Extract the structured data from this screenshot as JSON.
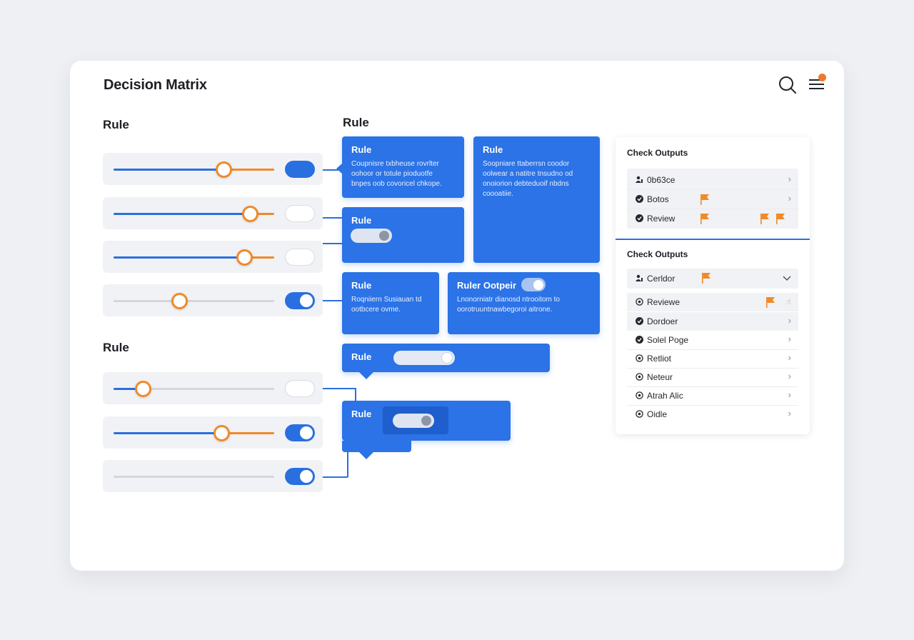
{
  "app": {
    "title": "Decision Matrix"
  },
  "left": {
    "section1_label": "Rule",
    "section2_label": "Rule"
  },
  "middle": {
    "section_label": "Rule",
    "cards": [
      {
        "title": "Rule",
        "body_lines": [
          "Coupnisre txbheuse rovrlter",
          "oohoor or totule pioduotfe",
          "bnpes oob covoricel chkope."
        ]
      },
      {
        "title": "Rule",
        "body_lines": [
          "Soopniare ttaberrsn coodor",
          "oolwear a natitre tnsudno od",
          "onoiorion debteduoif nbdns",
          "coooatiie."
        ]
      },
      {
        "title": "Rule"
      },
      {
        "title": "Rule",
        "body_lines": [
          "Roqniiern Susiauan td",
          "ootbcere ovme."
        ]
      },
      {
        "title": "Ruler Ootpeir",
        "body_lines": [
          "Lnonorniatr dianosd ntrooitom to",
          "oorotruuntnawbegoroi aitrone."
        ]
      },
      {
        "title": "Rule"
      },
      {
        "title": "Rule"
      }
    ]
  },
  "panel": {
    "title1": "Check Outputs",
    "rows1": [
      {
        "label": "0b63ce",
        "icon": "users-icon"
      },
      {
        "label": "Botos",
        "icon": "circle-check-icon"
      },
      {
        "label": "Review",
        "icon": "circle-check-icon"
      }
    ],
    "title2": "Check Outputs",
    "rows2": [
      {
        "label": "Cerldor",
        "icon": "users-icon"
      },
      {
        "label": "Reviewe",
        "icon": "circle-icon"
      },
      {
        "label": "Dordoer",
        "icon": "circle-check-icon"
      },
      {
        "label": "Solel Poge",
        "icon": "circle-check-icon"
      },
      {
        "label": "Retliot",
        "icon": "circle-icon"
      },
      {
        "label": "Neteur",
        "icon": "circle-icon"
      },
      {
        "label": "Atrah Alic",
        "icon": "circle-icon"
      },
      {
        "label": "Oidle",
        "icon": "circle-icon"
      }
    ]
  },
  "colors": {
    "accent_blue": "#2b73e6",
    "accent_orange": "#ef8a2a",
    "background": "#eef0f3"
  }
}
